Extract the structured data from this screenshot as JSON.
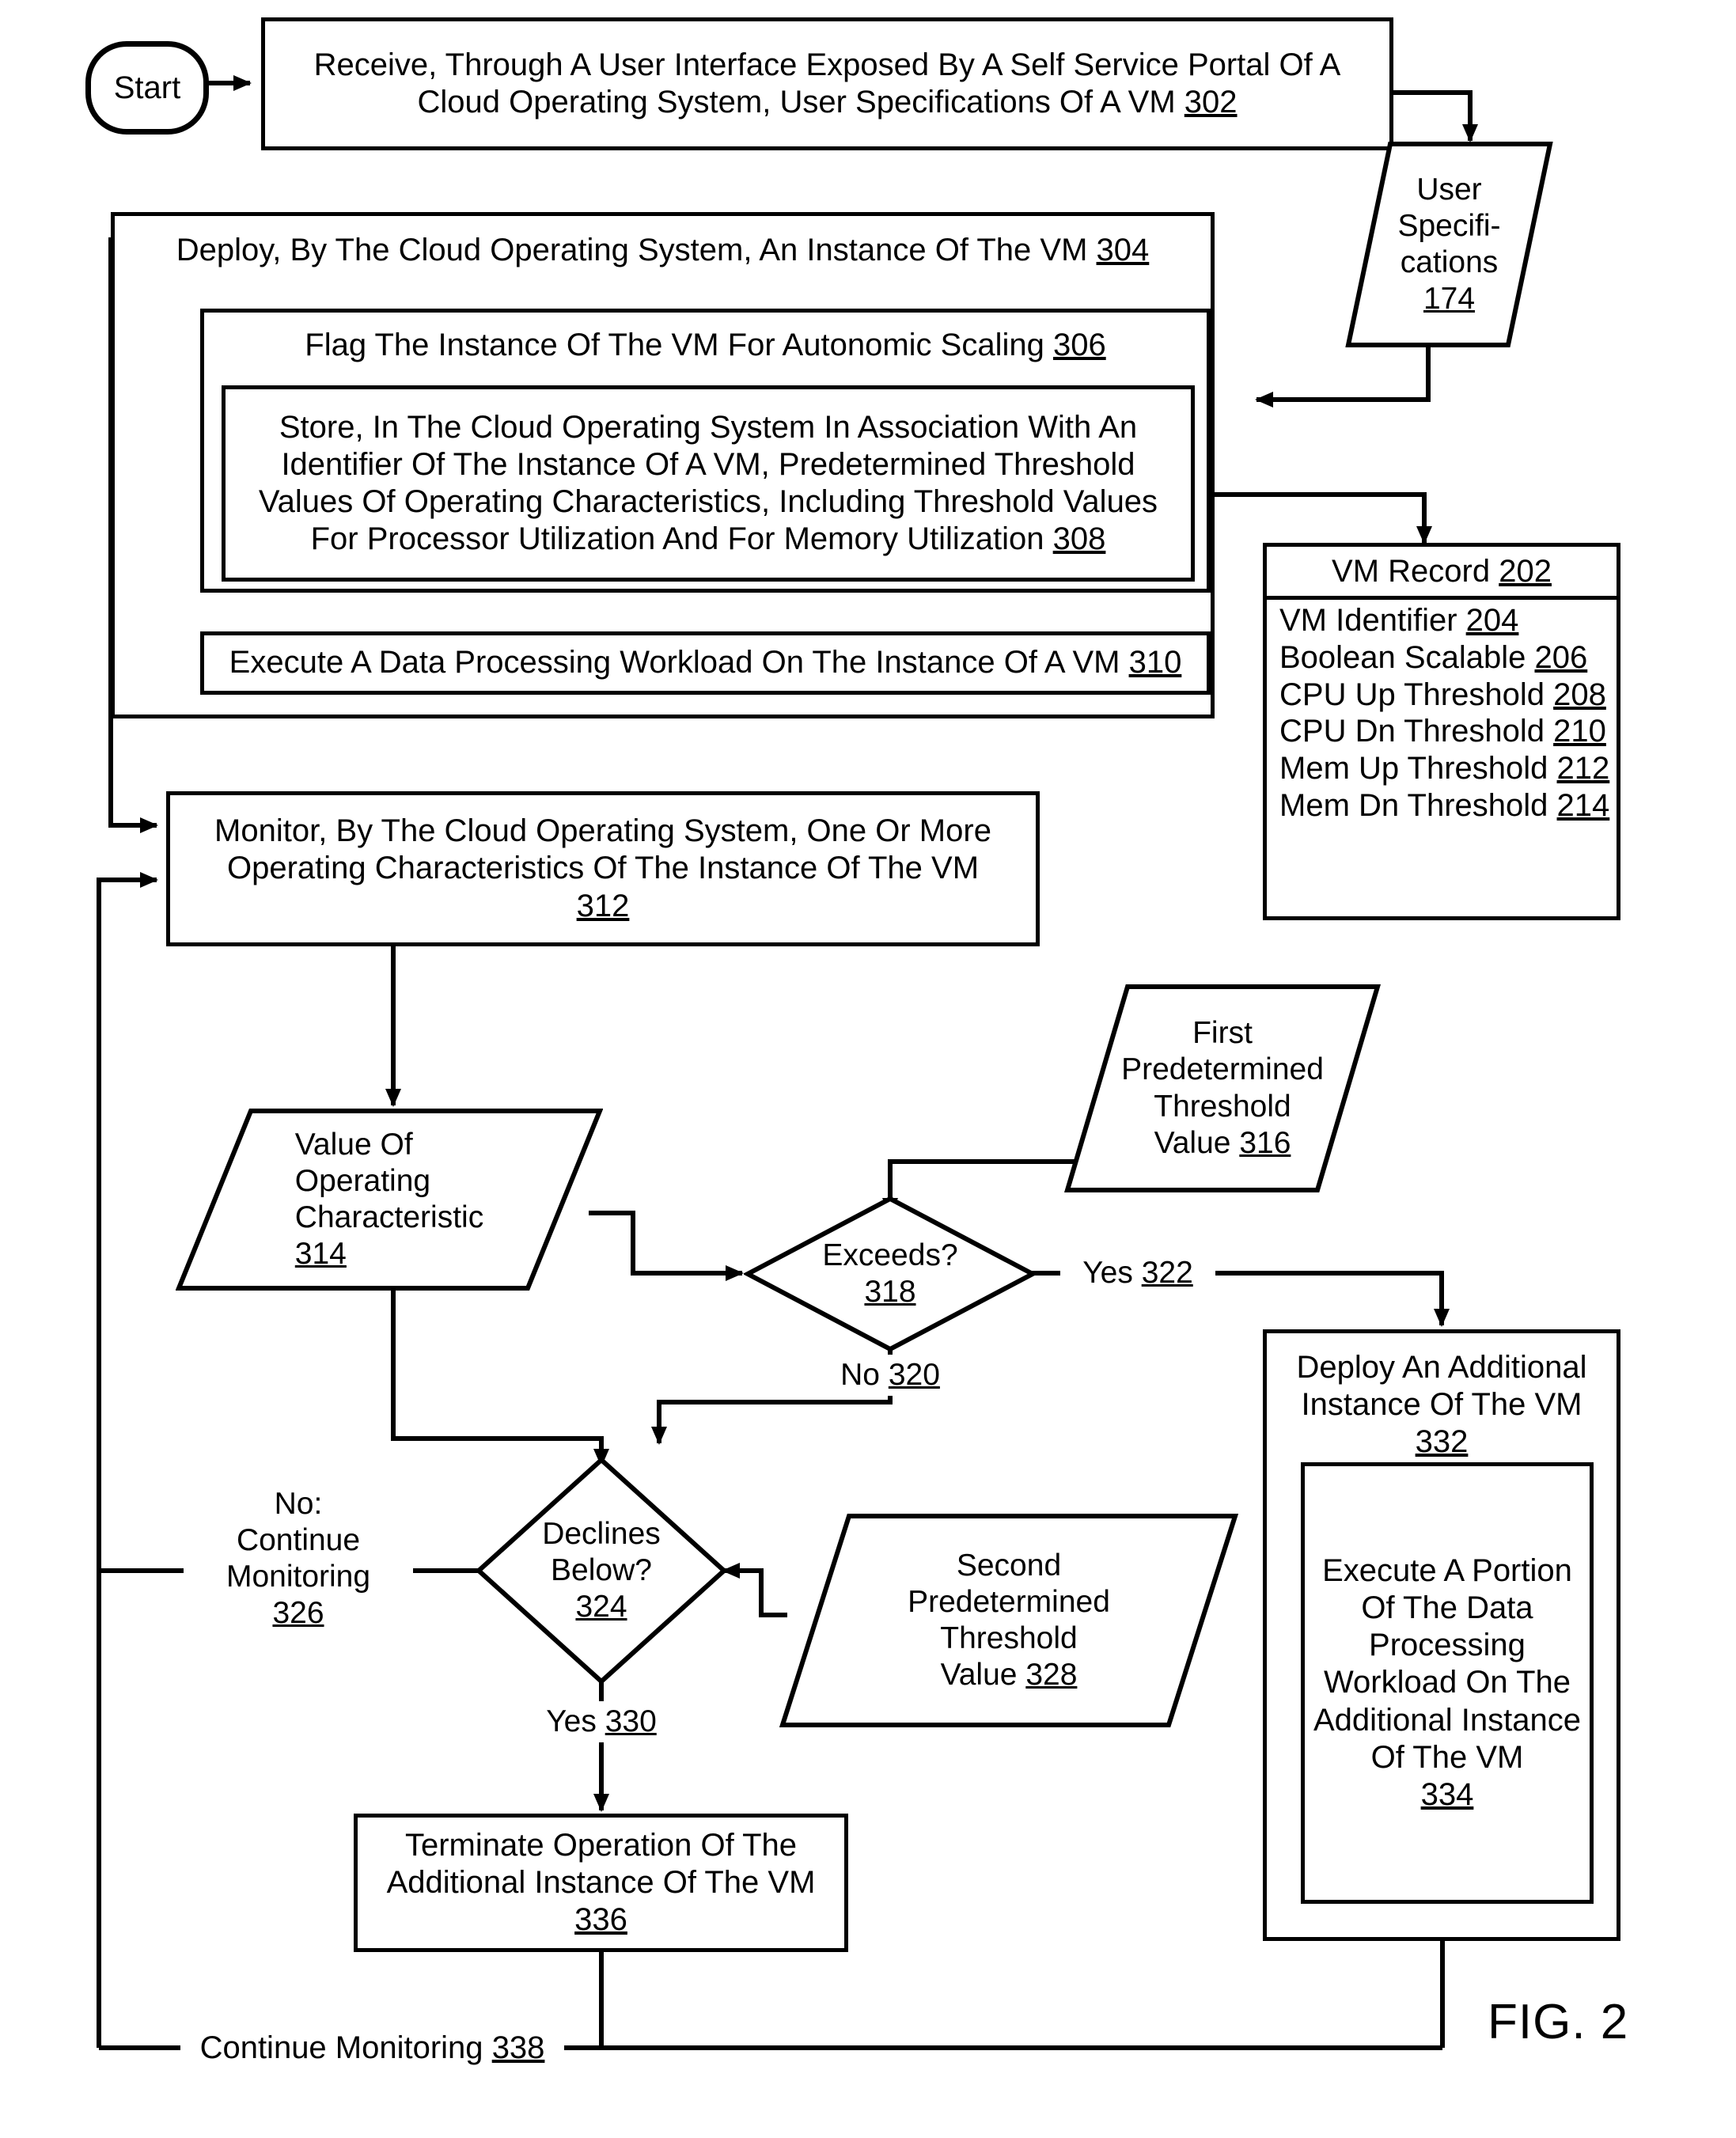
{
  "figure": {
    "label": "FIG. 2"
  },
  "nodes": {
    "start": {
      "label": "Start"
    },
    "receive_302": {
      "line1": "Receive, Through A User Interface Exposed By A Self Service Portal Of A",
      "line2": "Cloud Operating System, User Specifications Of A VM",
      "ref": "302"
    },
    "user_specs_174": {
      "line1": "User",
      "line2": "Specifi-",
      "line3": "cations",
      "ref": "174"
    },
    "deploy_304": {
      "text": "Deploy, By The Cloud Operating System, An Instance Of The VM",
      "ref": "304"
    },
    "flag_306": {
      "text": "Flag The Instance Of The VM For Autonomic Scaling",
      "ref": "306"
    },
    "store_308": {
      "line1": "Store, In The Cloud Operating System In Association With An",
      "line2": "Identifier Of The Instance Of A VM, Predetermined Threshold",
      "line3": "Values Of Operating Characteristics, Including Threshold Values",
      "line4": "For Processor Utilization And For Memory Utilization",
      "ref": "308"
    },
    "execute_310": {
      "text": "Execute A Data Processing Workload On The Instance Of A VM",
      "ref": "310"
    },
    "vm_record_202": {
      "title": "VM Record",
      "title_ref": "202",
      "fields": [
        {
          "label": "VM Identifier",
          "ref": "204"
        },
        {
          "label": "Boolean Scalable",
          "ref": "206"
        },
        {
          "label": "CPU Up Threshold",
          "ref": "208"
        },
        {
          "label": "CPU Dn Threshold",
          "ref": "210"
        },
        {
          "label": "Mem Up Threshold",
          "ref": "212"
        },
        {
          "label": "Mem Dn Threshold",
          "ref": "214"
        }
      ]
    },
    "monitor_312": {
      "line1": "Monitor, By The Cloud Operating System, One Or More",
      "line2": "Operating Characteristics Of The Instance Of The VM",
      "ref": "312"
    },
    "value_314": {
      "line1": "Value Of",
      "line2": "Operating",
      "line3": "Characteristic",
      "ref": "314"
    },
    "first_threshold_316": {
      "line1": "First",
      "line2": "Predetermined",
      "line3": "Threshold",
      "line4": "Value",
      "ref": "316"
    },
    "exceeds_318": {
      "text": "Exceeds?",
      "ref": "318"
    },
    "no_320": {
      "text": "No",
      "ref": "320"
    },
    "yes_322": {
      "text": "Yes",
      "ref": "322"
    },
    "declines_324": {
      "line1": "Declines",
      "line2": "Below?",
      "ref": "324"
    },
    "no_continue_326": {
      "line1": "No:",
      "line2": "Continue",
      "line3": "Monitoring",
      "ref": "326"
    },
    "second_threshold_328": {
      "line1": "Second",
      "line2": "Predetermined",
      "line3": "Threshold",
      "line4": "Value",
      "ref": "328"
    },
    "yes_330": {
      "text": "Yes",
      "ref": "330"
    },
    "deploy_additional_332": {
      "line1": "Deploy An Additional",
      "line2": "Instance Of The VM",
      "ref": "332"
    },
    "execute_portion_334": {
      "line1": "Execute A Portion",
      "line2": "Of The Data",
      "line3": "Processing",
      "line4": "Workload On The",
      "line5": "Additional Instance",
      "line6": "Of The VM",
      "ref": "334"
    },
    "terminate_336": {
      "line1": "Terminate Operation Of The",
      "line2": "Additional Instance Of The VM",
      "ref": "336"
    },
    "continue_monitoring_338": {
      "text": "Continue Monitoring",
      "ref": "338"
    }
  },
  "colors": {
    "stroke": "#000000",
    "background": "#ffffff"
  }
}
